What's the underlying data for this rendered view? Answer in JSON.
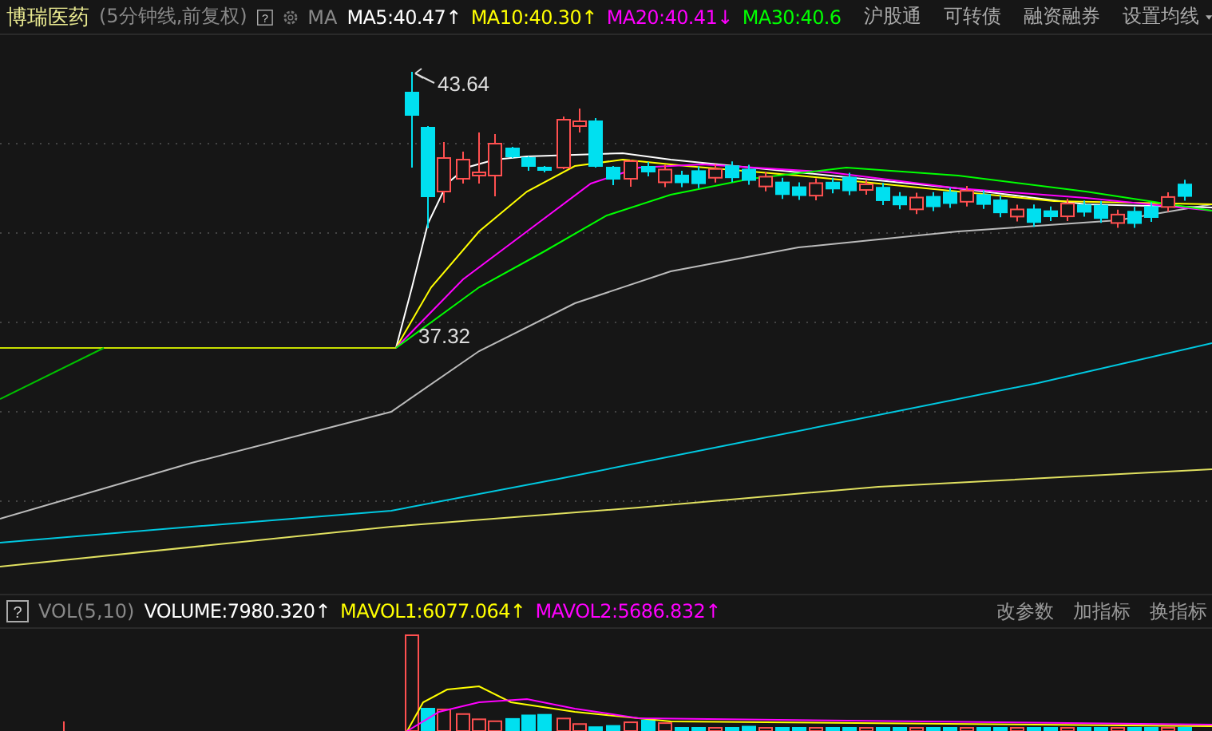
{
  "header": {
    "stock_name": "博瑞医药",
    "period": "(5分钟线,前复权)",
    "ma_label": "MA",
    "indicators": [
      {
        "text": "MA5:40.47",
        "arrow": "↑",
        "color": "#ffffff"
      },
      {
        "text": "MA10:40.30",
        "arrow": "↑",
        "color": "#ffff00"
      },
      {
        "text": "MA20:40.41",
        "arrow": "↓",
        "color": "#ff00ff"
      },
      {
        "text": "MA30:40.6",
        "color": "#00ff00"
      }
    ],
    "menu": [
      "沪股通",
      "可转债",
      "融资融券",
      "设置均线"
    ]
  },
  "help_mark": "?",
  "main_chart": {
    "high_label": "43.64",
    "low_label": "37.32"
  },
  "volume": {
    "label": "VOL(5,10)",
    "indicators": [
      {
        "text": "VOLUME:7980.320",
        "arrow": "↑",
        "color": "#ffffff"
      },
      {
        "text": "MAVOL1:6077.064",
        "arrow": "↑",
        "color": "#ffff00"
      },
      {
        "text": "MAVOL2:5686.832",
        "arrow": "↑",
        "color": "#ff00ff"
      }
    ],
    "buttons": [
      "改参数",
      "加指标",
      "换指标"
    ]
  }
}
